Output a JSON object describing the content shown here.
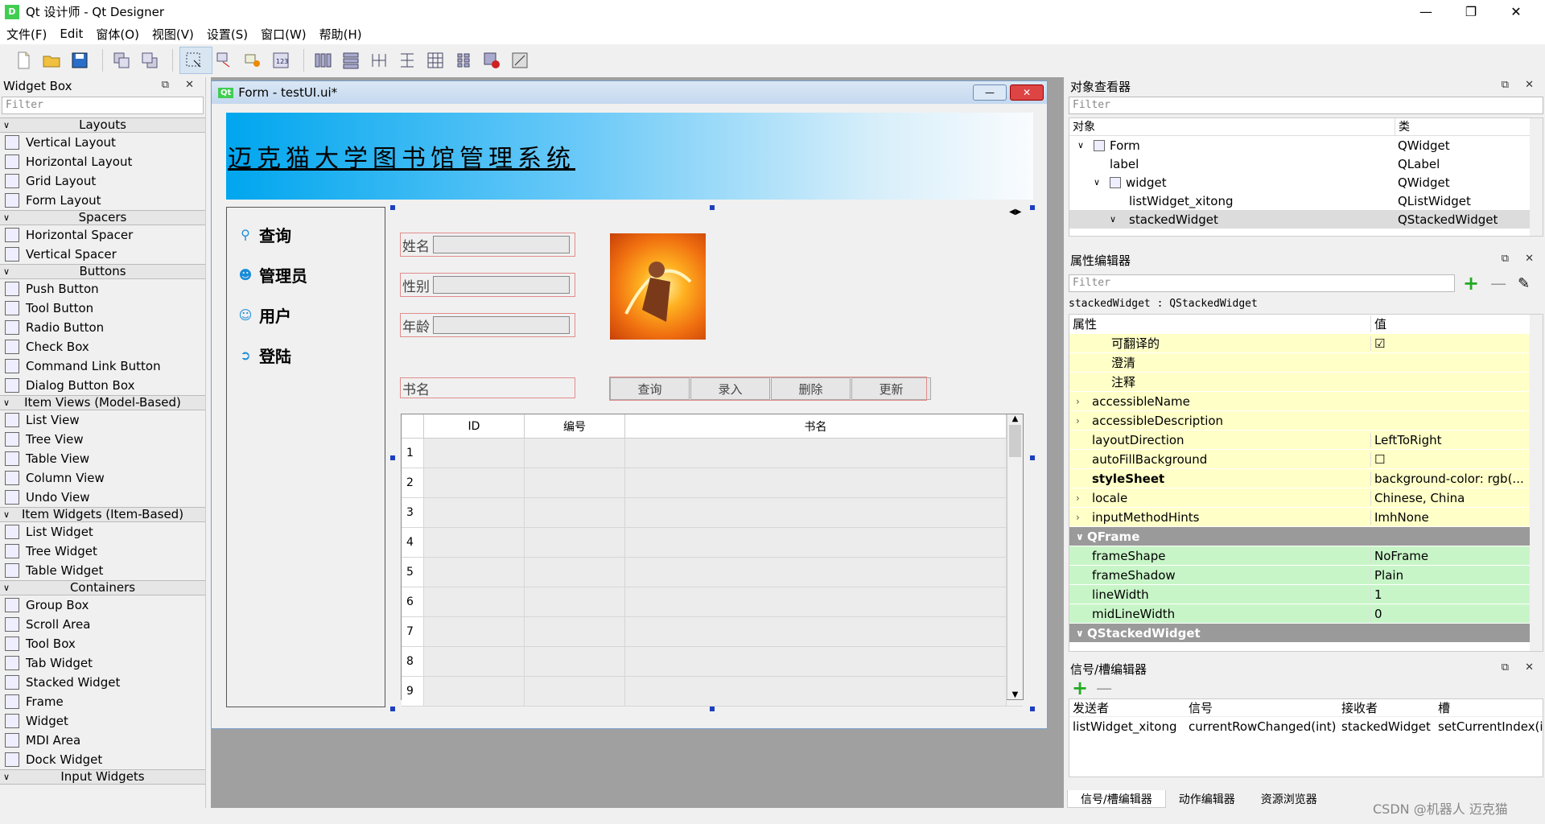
{
  "window": {
    "title": "Qt 设计师 - Qt Designer",
    "app_icon": "D"
  },
  "menu": [
    "文件(F)",
    "Edit",
    "窗体(O)",
    "视图(V)",
    "设置(S)",
    "窗口(W)",
    "帮助(H)"
  ],
  "widget_box": {
    "title": "Widget Box",
    "filter_placeholder": "Filter",
    "categories": [
      {
        "name": "Layouts",
        "items": [
          "Vertical Layout",
          "Horizontal Layout",
          "Grid Layout",
          "Form Layout"
        ]
      },
      {
        "name": "Spacers",
        "items": [
          "Horizontal Spacer",
          "Vertical Spacer"
        ]
      },
      {
        "name": "Buttons",
        "items": [
          "Push Button",
          "Tool Button",
          "Radio Button",
          "Check Box",
          "Command Link Button",
          "Dialog Button Box"
        ]
      },
      {
        "name": "Item Views (Model-Based)",
        "items": [
          "List View",
          "Tree View",
          "Table View",
          "Column View",
          "Undo View"
        ]
      },
      {
        "name": "Item Widgets (Item-Based)",
        "items": [
          "List Widget",
          "Tree Widget",
          "Table Widget"
        ]
      },
      {
        "name": "Containers",
        "items": [
          "Group Box",
          "Scroll Area",
          "Tool Box",
          "Tab Widget",
          "Stacked Widget",
          "Frame",
          "Widget",
          "MDI Area",
          "Dock Widget"
        ]
      },
      {
        "name": "Input Widgets",
        "items": []
      }
    ]
  },
  "form": {
    "window_title": "Form - testUI.ui*",
    "banner": "迈克猫大学图书馆管理系统",
    "nav": [
      "查询",
      "管理员",
      "用户",
      "登陆"
    ],
    "fields": {
      "name": "姓名",
      "gender": "性别",
      "age": "年龄",
      "book": "书名"
    },
    "buttons": [
      "查询",
      "录入",
      "删除",
      "更新"
    ],
    "table": {
      "columns": [
        "ID",
        "编号",
        "书名"
      ],
      "rows": [
        "1",
        "2",
        "3",
        "4",
        "5",
        "6",
        "7",
        "8",
        "9"
      ]
    }
  },
  "object_inspector": {
    "title": "对象查看器",
    "filter_placeholder": "Filter",
    "col_object": "对象",
    "col_class": "类",
    "rows": [
      {
        "name": "Form",
        "cls": "QWidget"
      },
      {
        "name": "label",
        "cls": "QLabel"
      },
      {
        "name": "widget",
        "cls": "QWidget"
      },
      {
        "name": "listWidget_xitong",
        "cls": "QListWidget"
      },
      {
        "name": "stackedWidget",
        "cls": "QStackedWidget"
      }
    ]
  },
  "property_editor": {
    "title": "属性编辑器",
    "filter_placeholder": "Filter",
    "object_label": "stackedWidget : QStackedWidget",
    "col_prop": "属性",
    "col_value": "值",
    "rows": [
      {
        "name": "可翻译的",
        "value": "☑",
        "style": "y"
      },
      {
        "name": "澄清",
        "value": "",
        "style": "y"
      },
      {
        "name": "注释",
        "value": "",
        "style": "y"
      },
      {
        "name": "accessibleName",
        "value": "",
        "style": "y"
      },
      {
        "name": "accessibleDescription",
        "value": "",
        "style": "y"
      },
      {
        "name": "layoutDirection",
        "value": "LeftToRight",
        "style": "y"
      },
      {
        "name": "autoFillBackground",
        "value": "☐",
        "style": "y"
      },
      {
        "name": "styleSheet",
        "value": "background-color: rgb(...",
        "style": "y"
      },
      {
        "name": "locale",
        "value": "Chinese, China",
        "style": "y"
      },
      {
        "name": "inputMethodHints",
        "value": "ImhNone",
        "style": "y"
      },
      {
        "name": "QFrame",
        "value": "",
        "style": "hd"
      },
      {
        "name": "frameShape",
        "value": "NoFrame",
        "style": "g"
      },
      {
        "name": "frameShadow",
        "value": "Plain",
        "style": "g"
      },
      {
        "name": "lineWidth",
        "value": "1",
        "style": "g"
      },
      {
        "name": "midLineWidth",
        "value": "0",
        "style": "g"
      },
      {
        "name": "QStackedWidget",
        "value": "",
        "style": "hd"
      }
    ]
  },
  "signal_editor": {
    "title": "信号/槽编辑器",
    "headers": [
      "发送者",
      "信号",
      "接收者",
      "槽"
    ],
    "row": [
      "listWidget_xitong",
      "currentRowChanged(int)",
      "stackedWidget",
      "setCurrentIndex(in"
    ]
  },
  "bottom_tabs": [
    "信号/槽编辑器",
    "动作编辑器",
    "资源浏览器"
  ],
  "watermark": "CSDN @机器人 迈克猫"
}
